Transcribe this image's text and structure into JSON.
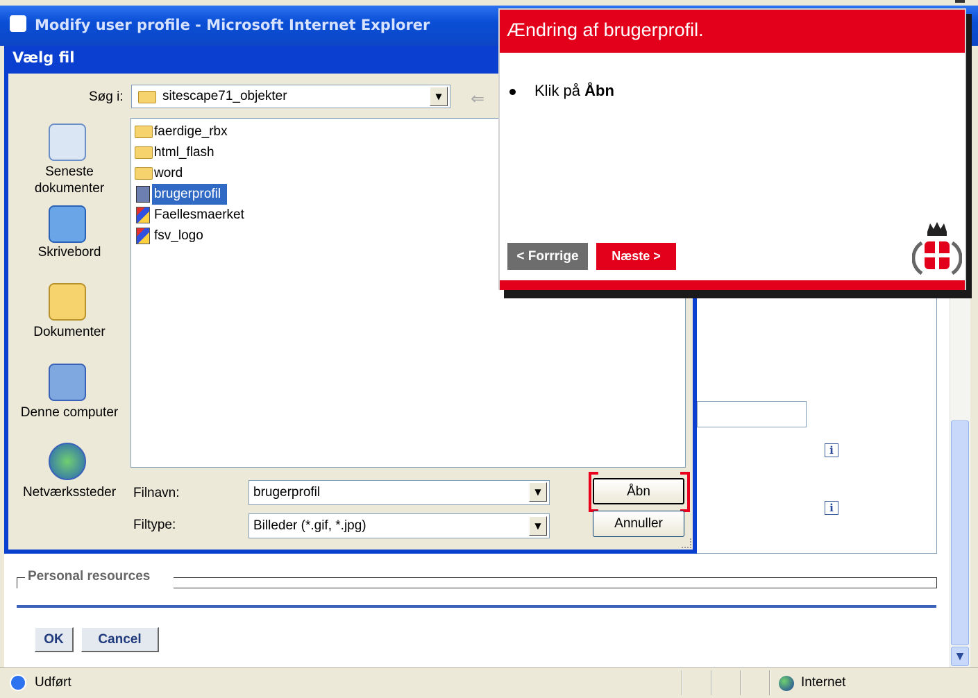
{
  "browser": {
    "title": "Modify user profile - Microsoft Internet Explorer",
    "status_text": "Udført",
    "zone_text": "Internet"
  },
  "page": {
    "resources_legend": "Personal resources",
    "ok_label": "OK",
    "cancel_label": "Cancel",
    "info_glyph": "i"
  },
  "file_dialog": {
    "title": "Vælg fil",
    "look_in_label": "Søg i:",
    "look_in_value": "sitescape71_objekter",
    "places": [
      {
        "label": "Seneste dokumenter",
        "icon": "recent-documents-icon"
      },
      {
        "label": "Skrivebord",
        "icon": "desktop-icon"
      },
      {
        "label": "Dokumenter",
        "icon": "my-documents-icon"
      },
      {
        "label": "Denne computer",
        "icon": "my-computer-icon"
      },
      {
        "label": "Netværkssteder",
        "icon": "network-places-icon"
      }
    ],
    "files": [
      {
        "name": "faerdige_rbx",
        "type": "folder"
      },
      {
        "name": "html_flash",
        "type": "folder"
      },
      {
        "name": "word",
        "type": "folder"
      },
      {
        "name": "brugerprofil",
        "type": "file",
        "selected": true
      },
      {
        "name": "Faellesmaerket",
        "type": "image"
      },
      {
        "name": "fsv_logo",
        "type": "image"
      }
    ],
    "filename_label": "Filnavn:",
    "filename_value": "brugerprofil",
    "filetype_label": "Filtype:",
    "filetype_value": "Billeder (*.gif, *.jpg)",
    "open_label": "Åbn",
    "cancel_label": "Annuller"
  },
  "tutorial": {
    "title": "Ændring af brugerprofil.",
    "instruction_prefix": "Klik på ",
    "instruction_bold": "Åbn",
    "prev_label": "< Forrrige",
    "next_label": "Næste >",
    "accent_color": "#e2001a"
  }
}
